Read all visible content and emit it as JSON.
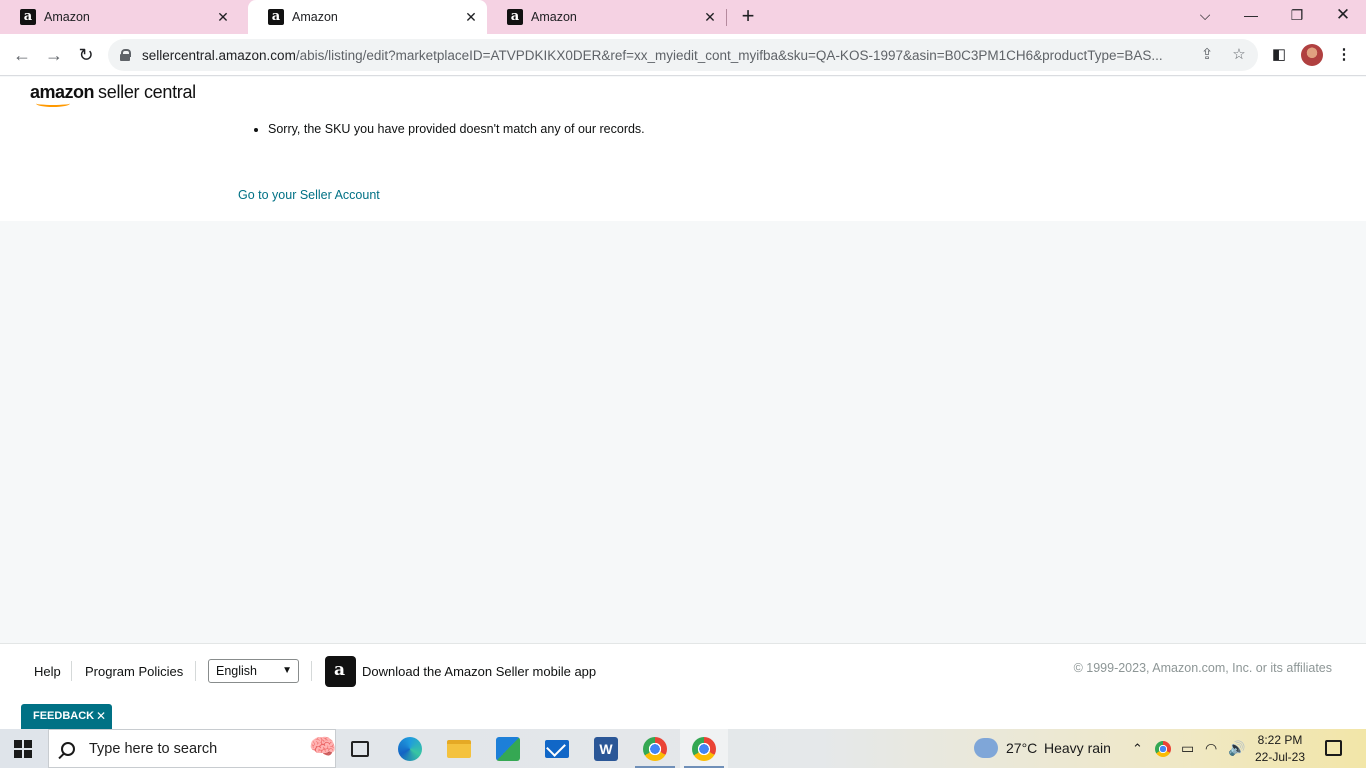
{
  "browser": {
    "tabs": [
      {
        "title": "Amazon",
        "favicon": "a"
      },
      {
        "title": "Amazon",
        "favicon": "a"
      },
      {
        "title": "Amazon",
        "favicon": "a"
      }
    ],
    "active_tab_index": 1,
    "url_host": "sellercentral.amazon.com",
    "url_path": "/abis/listing/edit?marketplaceID=ATVPDKIKX0DER&ref=xx_myiedit_cont_myifba&sku=QA-KOS-1997&asin=B0C3PM1CH6&productType=BAS..."
  },
  "page": {
    "logo_amazon": "amazon",
    "logo_seller": "seller central",
    "errors": [
      "Sorry, the SKU you have provided doesn't match any of our records."
    ],
    "seller_link": "Go to your Seller Account"
  },
  "footer": {
    "help": "Help",
    "policies": "Program Policies",
    "language": "English",
    "app_text": "Download the Amazon Seller mobile app",
    "copyright": "© 1999-2023, Amazon.com, Inc. or its affiliates",
    "feedback": "FEEDBACK"
  },
  "taskbar": {
    "search_placeholder": "Type here to search",
    "temperature": "27°C",
    "weather": "Heavy rain",
    "time": "8:22 PM",
    "date": "22-Jul-23"
  },
  "colors": {
    "tabstrip": "#f5d2e3",
    "link": "#007185",
    "accent": "#ff9900"
  }
}
